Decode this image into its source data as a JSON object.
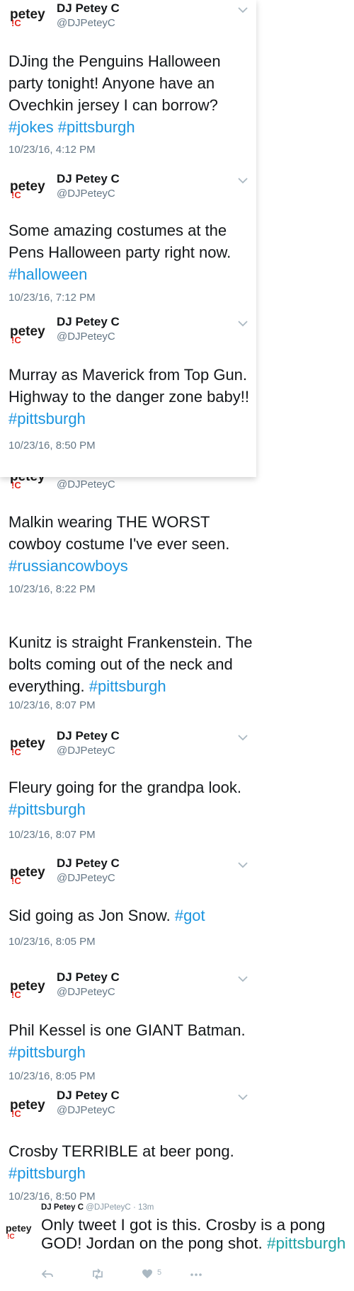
{
  "account": {
    "name": "DJ Petey C",
    "handle": "@DJPeteyC"
  },
  "logo": {
    "word": "petey",
    "mark": "!C",
    "color_text": "#1a1a1a",
    "color_mark": "#e2231a"
  },
  "colors": {
    "hashtag": "#1b95e0",
    "meta": "#657786",
    "text": "#14171a"
  },
  "tweets": [
    {
      "before": "DJing the Penguins Halloween party tonight! Anyone have an Ovechkin jersey I can borrow? ",
      "tags": [
        "#jokes",
        "#pittsburgh"
      ],
      "date": "10/23/16, 4:12 PM"
    },
    {
      "before": "Some amazing costumes at the Pens Halloween party right now. ",
      "tags": [
        "#halloween"
      ],
      "date": "10/23/16, 7:12 PM"
    },
    {
      "before": "Murray as Maverick from Top Gun. Highway to the danger zone baby!! ",
      "tags": [
        "#pittsburgh"
      ],
      "date": "10/23/16, 8:50 PM"
    },
    {
      "before": "Malkin wearing THE WORST cowboy costume I've ever seen. ",
      "tags": [
        "#russiancowboys"
      ],
      "date": "10/23/16, 8:22 PM"
    },
    {
      "before": "Kunitz is straight Frankenstein. The bolts coming out of the neck and everything. ",
      "tags": [
        "#pittsburgh"
      ],
      "date": "10/23/16, 8:07 PM"
    },
    {
      "before": "Fleury going for the grandpa look. ",
      "tags": [
        "#pittsburgh"
      ],
      "date": "10/23/16, 8:07 PM"
    },
    {
      "before": "Sid going as Jon Snow. ",
      "tags": [
        "#got"
      ],
      "date": "10/23/16, 8:05 PM"
    },
    {
      "before": "Phil Kessel is one GIANT Batman. ",
      "tags": [
        "#pittsburgh"
      ],
      "date": "10/23/16, 8:05 PM"
    },
    {
      "before": "Crosby TERRIBLE at beer pong. ",
      "tags": [
        "#pittsburgh"
      ],
      "date": "10/23/16, 8:50 PM"
    }
  ],
  "bottom_tweet": {
    "name": "DJ Petey C",
    "handle": "@DJPeteyC",
    "sep": "·",
    "time": "13m",
    "text": "Only tweet I got is this. Crosby is a pong GOD! Jordan on the pong shot. ",
    "tag": "#pittsburgh",
    "like_count": "5",
    "tag_color": "#1da1a4"
  },
  "icons": [
    "chevron-down-icon",
    "reply-icon",
    "retweet-icon",
    "heart-icon",
    "more-icon"
  ]
}
